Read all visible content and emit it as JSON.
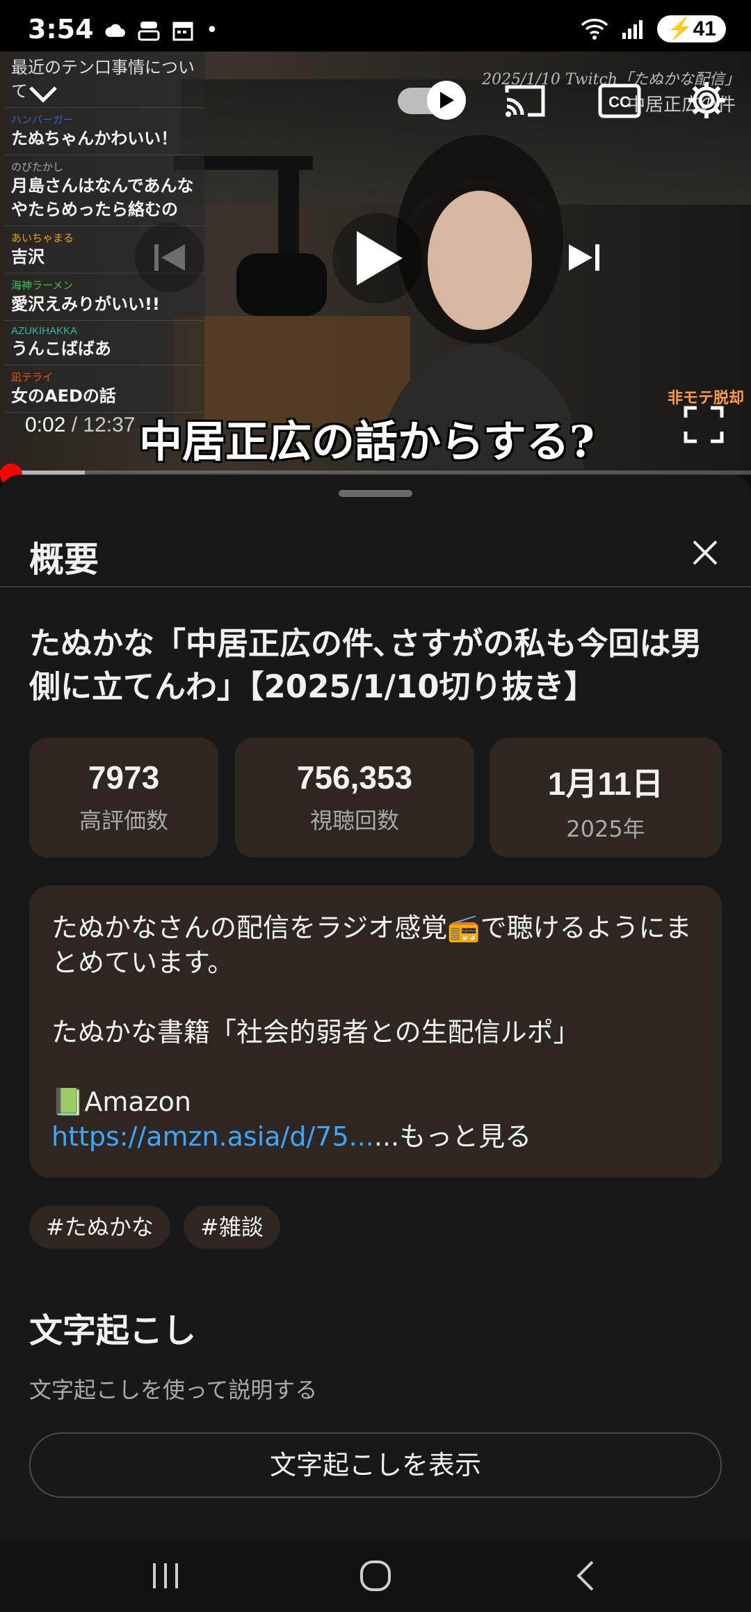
{
  "status_bar": {
    "time": "3:54",
    "dot": "•",
    "battery": "41"
  },
  "video": {
    "current_time": "0:02",
    "separator": " / ",
    "duration": "12:37",
    "caption_overlay": "中居正広の話からする?",
    "overlay_corner_date": "2025/1/10 Twitch「たぬかな配信」",
    "overlay_corner_topic": "中居正広の件",
    "brand_tag": "非モテ脱却",
    "chat": [
      {
        "user": "",
        "user_color": "#cccccc",
        "text": "最近のテン口事情について"
      },
      {
        "user": "ハンバーガー",
        "user_color": "#3b5bdb",
        "text": "たぬちゃんかわいい！"
      },
      {
        "user": "のびたかし",
        "user_color": "#aaaaaa",
        "text": "月島さんはなんであんなやたらめったら絡むの"
      },
      {
        "user": "あいちゃまる",
        "user_color": "#e6a700",
        "text": "吉沢"
      },
      {
        "user": "海神ラーメン",
        "user_color": "#40c057",
        "text": "愛沢えみりがいい!!"
      },
      {
        "user": "AZUKIHAKKA",
        "user_color": "#2fb9a8",
        "text": "うんこばばあ"
      },
      {
        "user": "凪テライ",
        "user_color": "#e8590c",
        "text": "女のAEDの話"
      }
    ]
  },
  "panel": {
    "title": "概要",
    "video_title": "たぬかな「中居正広の件､さすがの私も今回は男側に立てんわ」【2025/1/10切り抜き】",
    "stats": [
      {
        "value": "7973",
        "label": "高評価数"
      },
      {
        "value": "756,353",
        "label": "視聴回数"
      },
      {
        "value": "1月11日",
        "label": "2025年"
      }
    ],
    "description": {
      "line1": "たぬかなさんの配信をラジオ感覚",
      "line1_emoji": "📻",
      "line1_end": "で聴けるようにまとめています。",
      "line2": "たぬかな書籍「社会的弱者との生配信ルポ」",
      "book_emoji": "📗",
      "amazon": "Amazon",
      "link": "https://amzn.asia/d/75...",
      "more": "...もっと見る"
    },
    "tags": [
      "#たぬかな",
      "#雑談"
    ],
    "transcript": {
      "title": "文字起こし",
      "subtitle": "文字起こしを使って説明する",
      "button": "文字起こしを表示"
    }
  },
  "colors": {
    "accent_red": "#ff0000",
    "link_blue": "#3ea6ff",
    "card_bg": "#2e2621",
    "panel_bg": "#181818"
  }
}
